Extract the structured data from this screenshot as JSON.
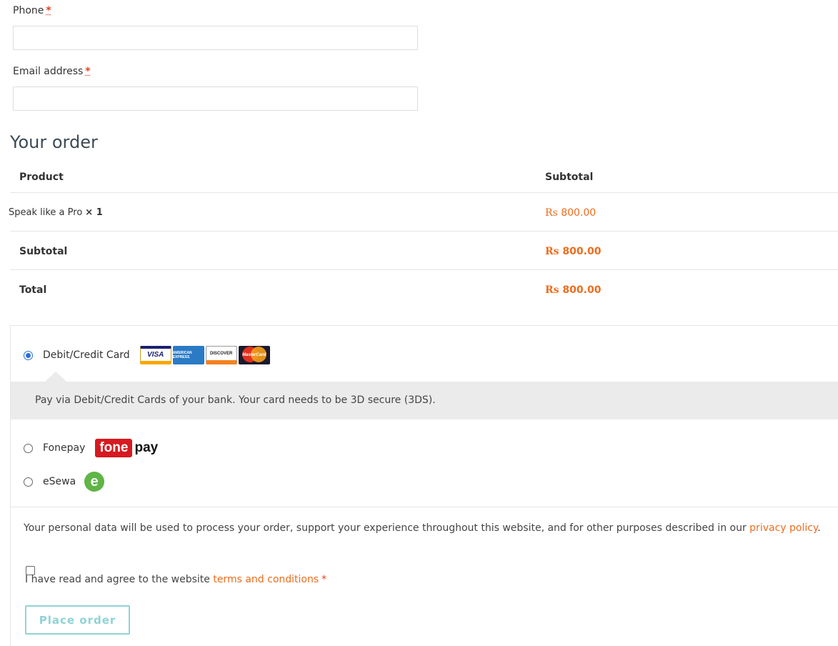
{
  "billing": {
    "phone": {
      "label": "Phone",
      "required_mark": "*",
      "value": ""
    },
    "email": {
      "label": "Email address",
      "required_mark": "*",
      "value": ""
    }
  },
  "order": {
    "heading": "Your order",
    "columns": {
      "product": "Product",
      "subtotal": "Subtotal"
    },
    "items": [
      {
        "name": "Speak like a Pro",
        "qty": "× 1",
        "currency": "Rs",
        "amount": "800.00"
      }
    ],
    "subtotal": {
      "label": "Subtotal",
      "currency": "Rs",
      "amount": "800.00"
    },
    "total": {
      "label": "Total",
      "currency": "Rs",
      "amount": "800.00"
    }
  },
  "payment": {
    "methods": [
      {
        "label": "Debit/Credit Card",
        "selected": true,
        "icons": [
          "visa-icon",
          "amex-icon",
          "discover-icon",
          "mastercard-icon"
        ]
      },
      {
        "label": "Fonepay",
        "selected": false,
        "logo_text_1": "fone",
        "logo_text_2": "pay"
      },
      {
        "label": "eSewa",
        "selected": false,
        "logo_text": "e"
      }
    ],
    "card_logos": {
      "visa": "VISA",
      "amex": "AMERICAN EXPRESS",
      "discover": "DISCOVER",
      "mastercard": "MasterCard"
    },
    "card_description": "Pay via Debit/Credit Cards of your bank. Your card needs to be 3D secure (3DS)."
  },
  "privacy": {
    "text": "Your personal data will be used to process your order, support your experience throughout this website, and for other purposes described in our",
    "link": "privacy policy",
    "end": "."
  },
  "terms": {
    "text": "I have read and agree to the website",
    "link": "terms and conditions",
    "required_mark": "*",
    "checked": false
  },
  "place_order_label": "Place order",
  "colors": {
    "accent": "#ee6c1d",
    "required": "#e2401c",
    "button": "#8fd3d6",
    "radio_selected": "#2b6fd6"
  }
}
